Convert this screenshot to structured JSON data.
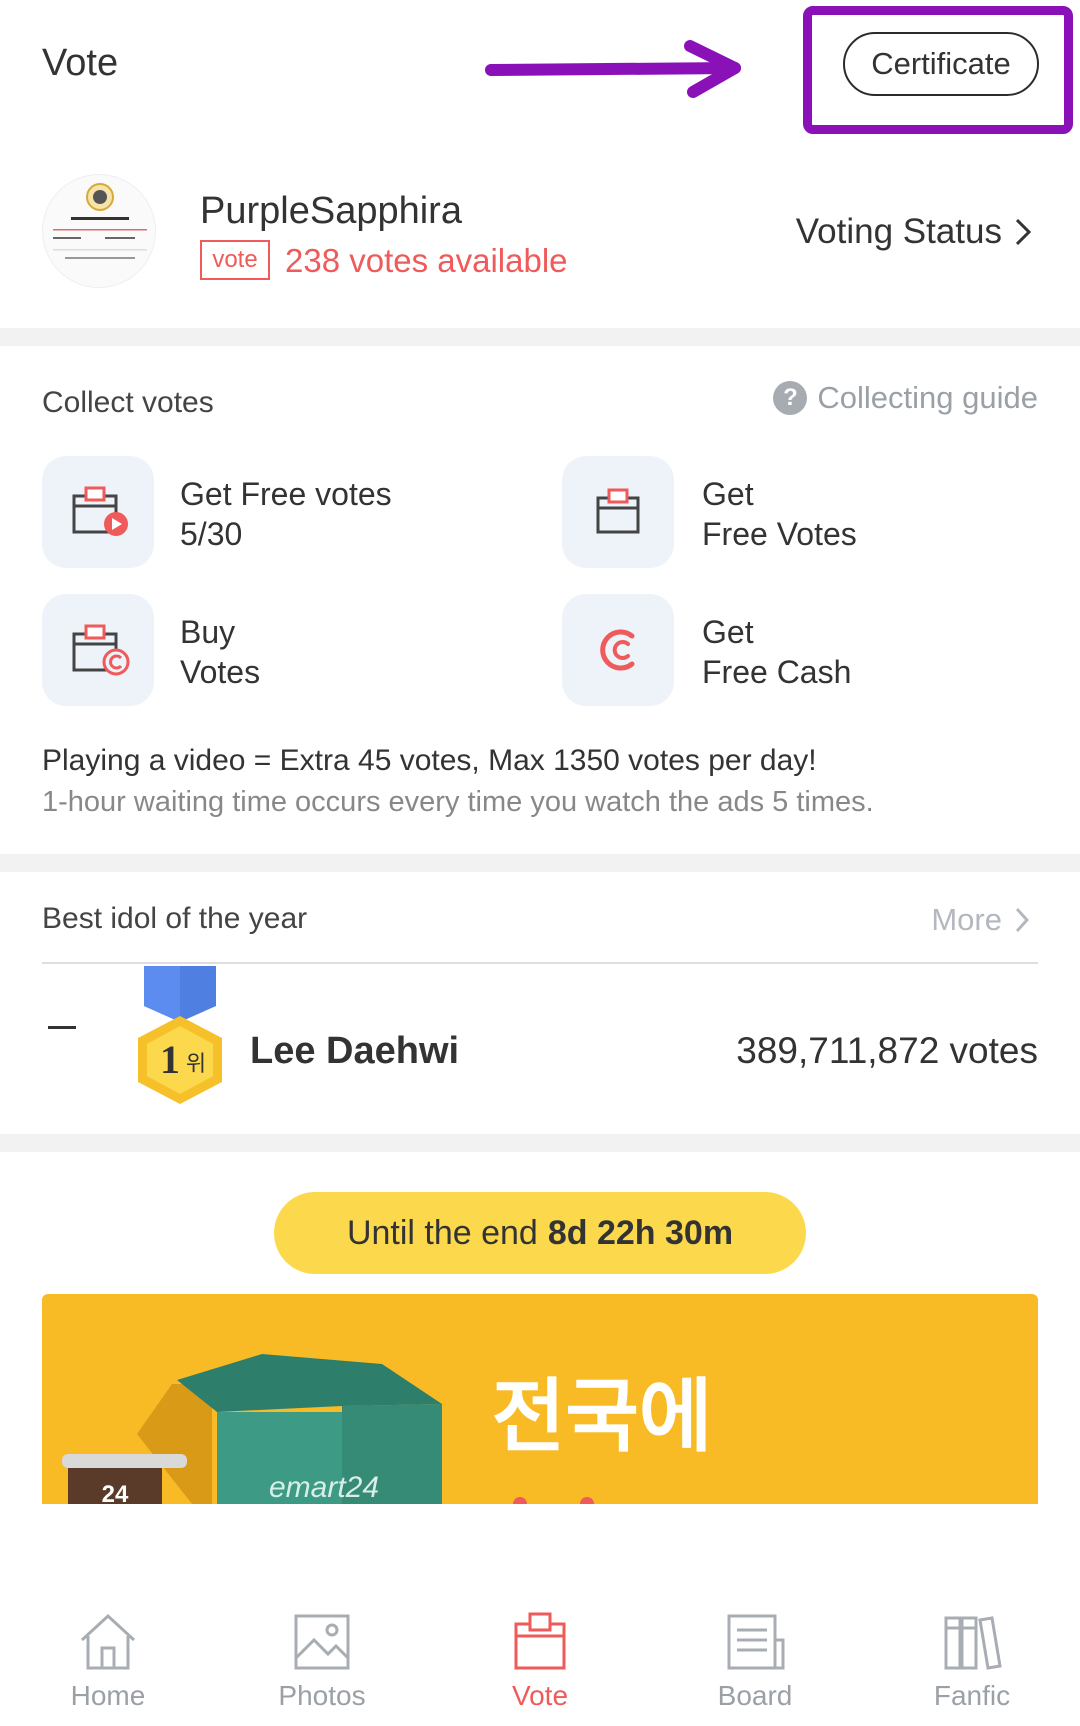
{
  "header": {
    "title": "Vote",
    "certificate_label": "Certificate"
  },
  "profile": {
    "username": "PurpleSapphira",
    "vote_badge": "vote",
    "votes_available": "238 votes available",
    "voting_status_label": "Voting Status"
  },
  "collect": {
    "title": "Collect votes",
    "guide_label": "Collecting guide",
    "items": [
      {
        "line1": "Get Free votes",
        "line2": "5/30",
        "icon": "video-ballot-icon"
      },
      {
        "line1": "Get",
        "line2": "Free Votes",
        "icon": "ballot-box-icon"
      },
      {
        "line1": "Buy",
        "line2": "Votes",
        "icon": "ballot-coin-icon"
      },
      {
        "line1": "Get",
        "line2": "Free Cash",
        "icon": "cash-c-icon"
      }
    ],
    "info_line1": "Playing a video = Extra 45 votes, Max 1350 votes per day!",
    "info_line2": "1-hour waiting time occurs every time you watch the ads 5 times."
  },
  "best_idol": {
    "title": "Best idol of the year",
    "more_label": "More",
    "rank_change": "—",
    "rank_number": "1",
    "rank_suffix": "위",
    "name": "Lee Daehwi",
    "votes": "389,711,872 votes"
  },
  "countdown": {
    "prefix": "Until the end",
    "time": "8d 22h 30m"
  },
  "banner": {
    "headline": "전국에",
    "brand": "emart24",
    "sign_text": "24"
  },
  "nav": {
    "items": [
      {
        "label": "Home",
        "icon": "home-icon"
      },
      {
        "label": "Photos",
        "icon": "photos-icon"
      },
      {
        "label": "Vote",
        "icon": "vote-icon",
        "active": true
      },
      {
        "label": "Board",
        "icon": "board-icon"
      },
      {
        "label": "Fanfic",
        "icon": "fanfic-icon"
      }
    ]
  },
  "colors": {
    "accent_red": "#ef5a5a",
    "annotation_purple": "#8a11b8",
    "countdown_yellow": "#fcd94c",
    "banner_orange": "#f8bb25"
  }
}
